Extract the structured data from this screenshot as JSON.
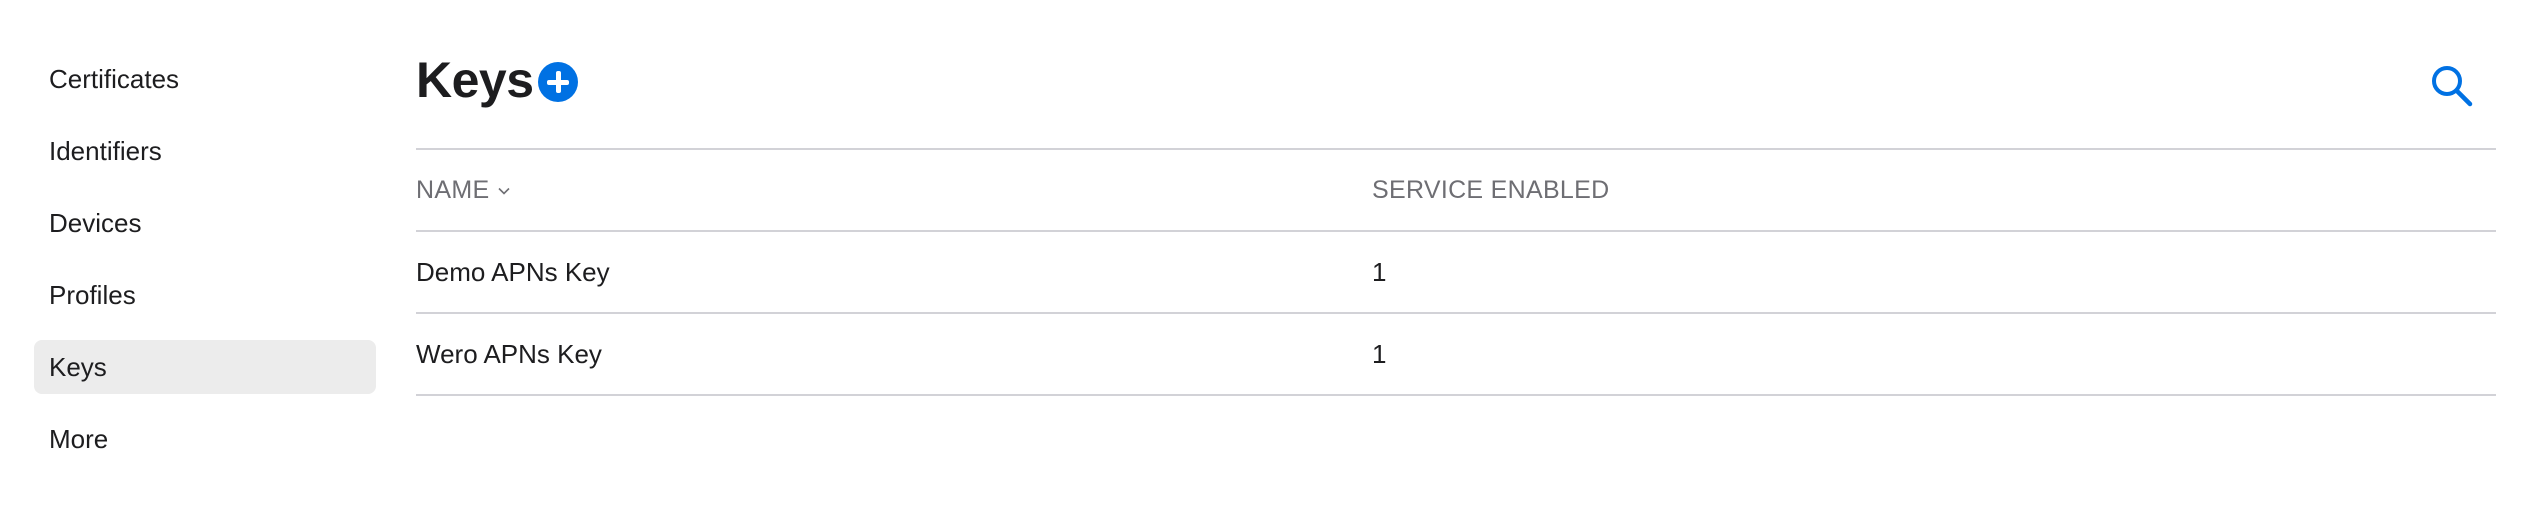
{
  "sidebar": {
    "items": [
      {
        "label": "Certificates",
        "active": false
      },
      {
        "label": "Identifiers",
        "active": false
      },
      {
        "label": "Devices",
        "active": false
      },
      {
        "label": "Profiles",
        "active": false
      },
      {
        "label": "Keys",
        "active": true
      },
      {
        "label": "More",
        "active": false
      }
    ]
  },
  "header": {
    "title": "Keys",
    "add_icon": "plus-circle-icon",
    "search_icon": "search-icon"
  },
  "table": {
    "columns": [
      {
        "label": "NAME",
        "sort_icon": "chevron-down-icon"
      },
      {
        "label": "SERVICE ENABLED"
      }
    ],
    "rows": [
      {
        "name": "Demo APNs Key",
        "services_enabled": "1"
      },
      {
        "name": "Wero APNs Key",
        "services_enabled": "1"
      }
    ]
  },
  "colors": {
    "accent": "#0071e3",
    "active_item_bg": "#ececec",
    "divider": "#d2d2d7",
    "muted_text": "#6e6e73"
  }
}
